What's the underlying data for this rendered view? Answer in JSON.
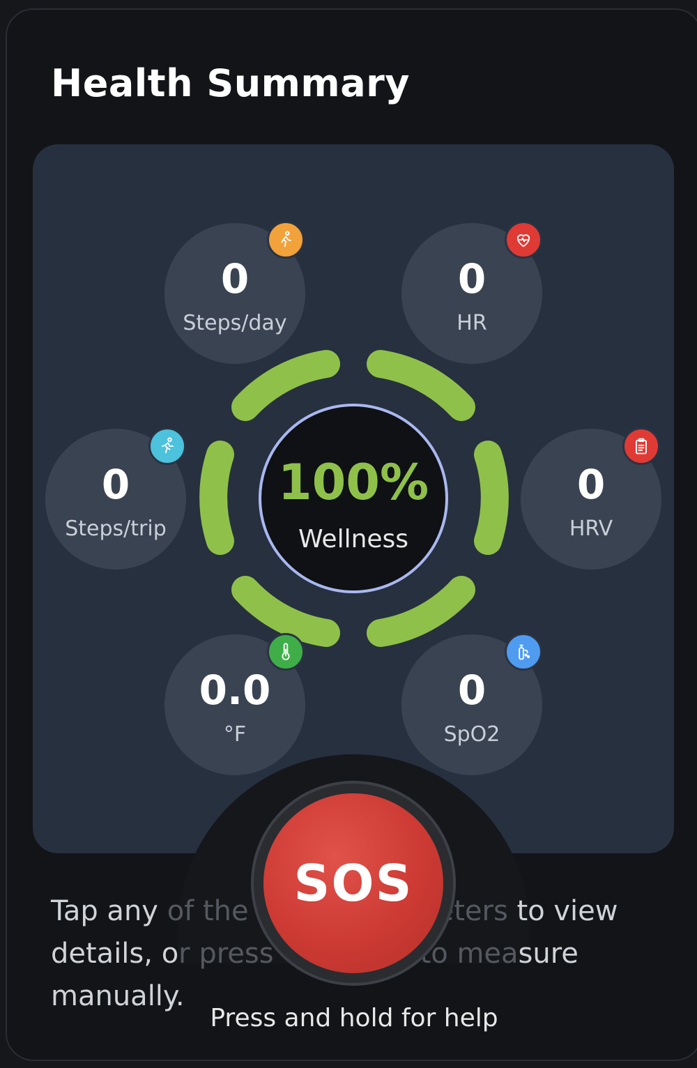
{
  "title": "Health Summary",
  "metrics": [
    {
      "id": "steps-day",
      "value": "0",
      "label": "Steps/day",
      "badge_color": "#f2a23a",
      "icon": "walking-icon"
    },
    {
      "id": "hr",
      "value": "0",
      "label": "HR",
      "badge_color": "#e03a35",
      "icon": "heart-pulse-icon"
    },
    {
      "id": "steps-trip",
      "value": "0",
      "label": "Steps/trip",
      "badge_color": "#4cc2dc",
      "icon": "running-icon"
    },
    {
      "id": "hrv",
      "value": "0",
      "label": "HRV",
      "badge_color": "#e03a35",
      "icon": "clipboard-icon"
    },
    {
      "id": "temp",
      "value": "0.0",
      "label": "°F",
      "badge_color": "#3fae49",
      "icon": "thermometer-icon"
    },
    {
      "id": "spo2",
      "value": "0",
      "label": "SpO2",
      "badge_color": "#4f9bf0",
      "icon": "oxygen-tank-icon"
    }
  ],
  "wellness": {
    "percent": "100%",
    "label": "Wellness",
    "ring_color": "#8fc14a",
    "fill_fraction": 1.0
  },
  "hint": {
    "part1": "Tap any ",
    "part1_dim": "of the",
    "part2_dim": "eters",
    "part2": " to view",
    "line2_a": "details, o",
    "line2_dim": "r press",
    "line2_dim2": "to mea",
    "line2_b": "sure",
    "line3": "manually."
  },
  "sos": {
    "label": "SOS",
    "caption": "Press and hold for help",
    "color": "#cc3a33"
  }
}
